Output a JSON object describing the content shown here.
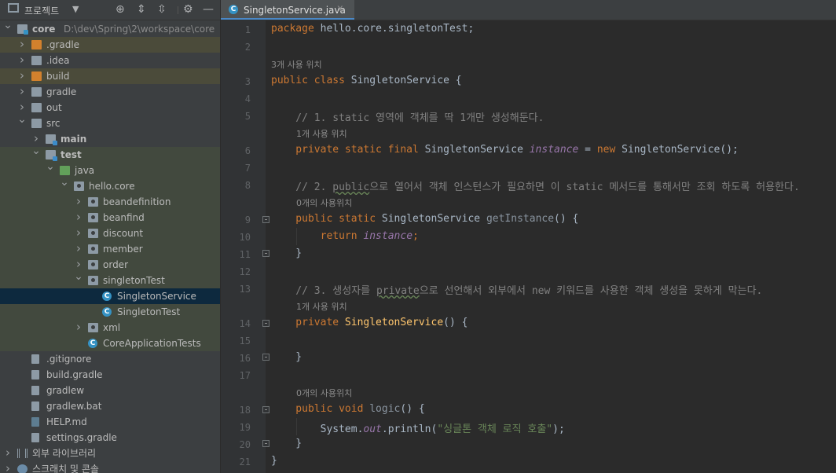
{
  "project_panel": {
    "title": "프로젝트",
    "tree": [
      {
        "label": "core",
        "path": "D:\\dev\\Spring\\2\\workspace\\core",
        "indent": 0,
        "arrow": "down",
        "icon": "folder-module",
        "bold": true,
        "bg": "none"
      },
      {
        "label": ".gradle",
        "indent": 1,
        "arrow": "right",
        "icon": "folder-orange",
        "bg": "excluded"
      },
      {
        "label": ".idea",
        "indent": 1,
        "arrow": "right",
        "icon": "folder",
        "bg": "none"
      },
      {
        "label": "build",
        "indent": 1,
        "arrow": "right",
        "icon": "folder-orange",
        "bg": "excluded"
      },
      {
        "label": "gradle",
        "indent": 1,
        "arrow": "right",
        "icon": "folder",
        "bg": "none"
      },
      {
        "label": "out",
        "indent": 1,
        "arrow": "right",
        "icon": "folder",
        "bg": "none"
      },
      {
        "label": "src",
        "indent": 1,
        "arrow": "down",
        "icon": "folder",
        "bg": "none"
      },
      {
        "label": "main",
        "indent": 2,
        "arrow": "right",
        "icon": "folder-src",
        "bold": true,
        "bg": "none"
      },
      {
        "label": "test",
        "indent": 2,
        "arrow": "down",
        "icon": "folder-src",
        "bold": true,
        "bg": "test"
      },
      {
        "label": "java",
        "indent": 3,
        "arrow": "down",
        "icon": "folder-green",
        "bg": "test"
      },
      {
        "label": "hello.core",
        "indent": 4,
        "arrow": "down",
        "icon": "package",
        "bg": "test"
      },
      {
        "label": "beandefinition",
        "indent": 5,
        "arrow": "right",
        "icon": "package",
        "bg": "test"
      },
      {
        "label": "beanfind",
        "indent": 5,
        "arrow": "right",
        "icon": "package",
        "bg": "test"
      },
      {
        "label": "discount",
        "indent": 5,
        "arrow": "right",
        "icon": "package",
        "bg": "test"
      },
      {
        "label": "member",
        "indent": 5,
        "arrow": "right",
        "icon": "package",
        "bg": "test"
      },
      {
        "label": "order",
        "indent": 5,
        "arrow": "right",
        "icon": "package",
        "bg": "test"
      },
      {
        "label": "singletonTest",
        "indent": 5,
        "arrow": "down",
        "icon": "package",
        "bg": "test"
      },
      {
        "label": "SingletonService",
        "indent": 6,
        "arrow": "none",
        "icon": "class",
        "bg": "selected"
      },
      {
        "label": "SingletonTest",
        "indent": 6,
        "arrow": "none",
        "icon": "class",
        "bg": "test"
      },
      {
        "label": "xml",
        "indent": 5,
        "arrow": "right",
        "icon": "package",
        "bg": "test"
      },
      {
        "label": "CoreApplicationTests",
        "indent": 5,
        "arrow": "none",
        "icon": "class",
        "bg": "test"
      },
      {
        "label": ".gitignore",
        "indent": 1,
        "arrow": "none",
        "icon": "file",
        "bg": "none"
      },
      {
        "label": "build.gradle",
        "indent": 1,
        "arrow": "none",
        "icon": "file",
        "bg": "none"
      },
      {
        "label": "gradlew",
        "indent": 1,
        "arrow": "none",
        "icon": "file",
        "bg": "none"
      },
      {
        "label": "gradlew.bat",
        "indent": 1,
        "arrow": "none",
        "icon": "file",
        "bg": "none"
      },
      {
        "label": "HELP.md",
        "indent": 1,
        "arrow": "none",
        "icon": "file-md",
        "bg": "none"
      },
      {
        "label": "settings.gradle",
        "indent": 1,
        "arrow": "none",
        "icon": "file",
        "bg": "none"
      },
      {
        "label": "외부 라이브러리",
        "indent": 0,
        "arrow": "right",
        "icon": "library",
        "bg": "none"
      },
      {
        "label": "스크래치 및 콘솔",
        "indent": 0,
        "arrow": "right",
        "icon": "scratch",
        "bg": "none"
      }
    ]
  },
  "editor": {
    "tab_title": "SingletonService.java",
    "tab_close": "x",
    "line_numbers": [
      "1",
      "2",
      "3",
      "4",
      "5",
      "6",
      "7",
      "8",
      "9",
      "10",
      "11",
      "12",
      "13",
      "14",
      "15",
      "16",
      "17",
      "18",
      "19",
      "20",
      "21"
    ],
    "hints": {
      "h1": "3개 사용 위치",
      "h2": "1개 사용 위치",
      "h3": "0개의 사용위치",
      "h4": "1개 사용 위치",
      "h5": "0개의 사용위치"
    },
    "code": {
      "l1_kw": "package",
      "l1_rest": " hello.core.singletonTest;",
      "l3_kw": "public class",
      "l3_rest": " SingletonService {",
      "l5": "    // 1. static 영역에 객체를 딱 1개만 생성해둔다.",
      "l6_kw": "    private static final",
      "l6_type": " SingletonService ",
      "l6_field": "instance",
      "l6_eq": " = ",
      "l6_new": "new",
      "l6_rest": " SingletonService();",
      "l8_a": "    // 2. ",
      "l8_b": "public",
      "l8_c": "으로 열어서 객체 인스턴스가 필요하면 이 static 메서드를 통해서만 조회 하도록 허용한다.",
      "l9_kw": "    public static",
      "l9_type": " SingletonService ",
      "l9_method": "getInstance",
      "l9_rest": "() {",
      "l10_kw": "        return",
      "l10_field": " instance",
      "l10_semi": ";",
      "l11": "    }",
      "l13_a": "    // 3. 생성자를 ",
      "l13_b": "private",
      "l13_c": "으로 선언해서 외부에서 new 키워드를 사용한 객체 생성을 못하게 막는다.",
      "l14_kw": "    private",
      "l14_method": " SingletonService",
      "l14_rest": "() {",
      "l16": "    }",
      "l18_kw": "    public void",
      "l18_method": " logic",
      "l18_rest": "() {",
      "l19_a": "        System.",
      "l19_b": "out",
      "l19_c": ".println(",
      "l19_str": "\"싱글톤 객체 로직 호출\"",
      "l19_d": ");",
      "l20": "    }",
      "l21": "}"
    }
  }
}
